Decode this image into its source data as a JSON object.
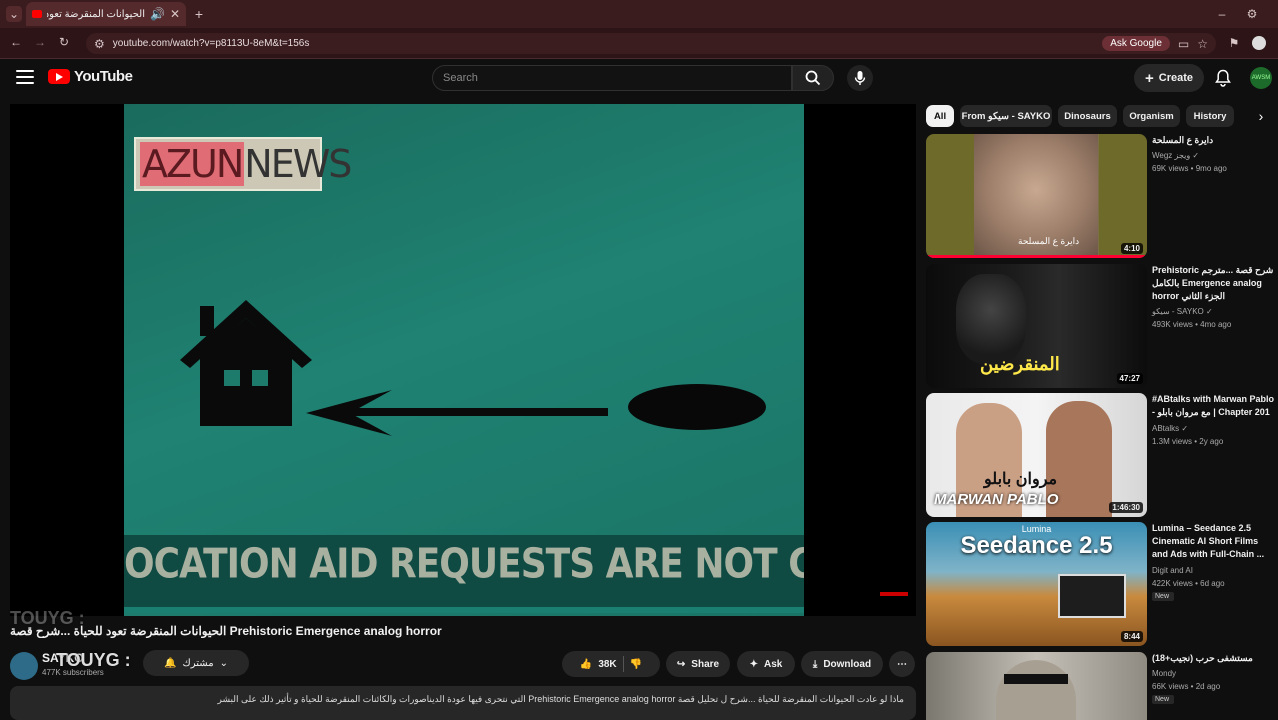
{
  "browser": {
    "tab_title": "الحيوانات المنقرضة تعود للح",
    "url": "youtube.com/watch?v=p8113U-8eM&t=156s",
    "ask_google": "Ask Google"
  },
  "header": {
    "logo_text": "YouTube",
    "search_placeholder": "Search",
    "create_label": "Create",
    "avatar_text": "AWSM"
  },
  "video": {
    "news_part1": "AZUN",
    "news_part2": "NEWS",
    "crawl_text": "OCATION AID REQUESTS ARE NOT GUARANTEED TO",
    "title": "الحيوانات المنقرضة تعود للحياة ...شرح قصة Prehistoric Emergence analog horror",
    "channel": "SAYKO",
    "subscribers": "477K subscribers",
    "subscribe_label": "مشترك",
    "overlay_tag": "TOUYG :",
    "overlay_tag2": "TOUYG :",
    "likes": "38K",
    "share_label": "Share",
    "ask_label": "Ask",
    "download_label": "Download",
    "description": "ماذا لو عادت الحيوانات المنقرضة للحياة ...شرح ل تحليل قصة Prehistoric Emergence analog horror التي نتحرى فيها عودة الديناصورات والكائنات المنقرضة للحياة و تأثير ذلك على البشر"
  },
  "chips": [
    "All",
    "From سيكو - SAYKO",
    "Dinosaurs",
    "Organism",
    "History"
  ],
  "recommendations": [
    {
      "title": "دايرة ع المسلحة",
      "channel": "Wegz ويجز ✓",
      "meta": "69K views • 9mo ago",
      "duration": "4:10",
      "thumb_text": "دايرة ع المسلحة",
      "badge": ""
    },
    {
      "title": "Prehistoric شرح قصة ...مترجم بالكامل Emergence analog horror الجزء الثاني",
      "channel": "سيكو - SAYKO ✓",
      "meta": "493K views • 4mo ago",
      "duration": "47:27",
      "thumb_text": "المنقرضين",
      "badge": ""
    },
    {
      "title": "#ABtalks with Marwan Pablo - مع مروان بابلو | Chapter 201",
      "channel": "ABtalks ✓",
      "meta": "1.3M views • 2y ago",
      "duration": "1:46:30",
      "thumb_text": "مروان بابلو",
      "thumb_text2": "MARWAN PABLO",
      "badge": ""
    },
    {
      "title": "Lumina – Seedance 2.5 Cinematic AI Short Films and Ads with Full-Chain ...",
      "channel": "Digit and AI",
      "meta": "422K views • 6d ago",
      "duration": "8:44",
      "thumb_text": "Seedance 2.5",
      "thumb_small": "Lumina",
      "badge": "New"
    },
    {
      "title": "مستشفى حرب (نجيب+18)",
      "channel": "Mondy",
      "meta": "66K views • 2d ago",
      "duration": "",
      "thumb_text": "",
      "badge": "New"
    }
  ]
}
